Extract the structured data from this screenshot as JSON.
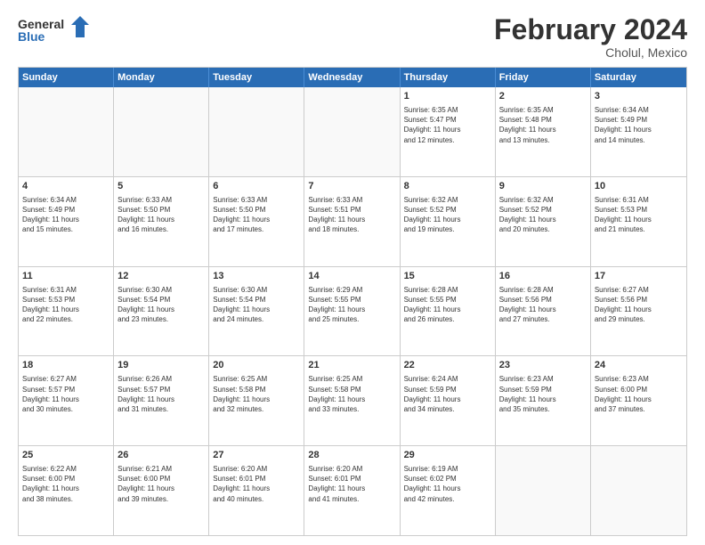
{
  "logo": {
    "line1": "General",
    "line2": "Blue"
  },
  "title": "February 2024",
  "subtitle": "Cholul, Mexico",
  "header_days": [
    "Sunday",
    "Monday",
    "Tuesday",
    "Wednesday",
    "Thursday",
    "Friday",
    "Saturday"
  ],
  "rows": [
    [
      {
        "day": "",
        "text": ""
      },
      {
        "day": "",
        "text": ""
      },
      {
        "day": "",
        "text": ""
      },
      {
        "day": "",
        "text": ""
      },
      {
        "day": "1",
        "text": "Sunrise: 6:35 AM\nSunset: 5:47 PM\nDaylight: 11 hours\nand 12 minutes."
      },
      {
        "day": "2",
        "text": "Sunrise: 6:35 AM\nSunset: 5:48 PM\nDaylight: 11 hours\nand 13 minutes."
      },
      {
        "day": "3",
        "text": "Sunrise: 6:34 AM\nSunset: 5:49 PM\nDaylight: 11 hours\nand 14 minutes."
      }
    ],
    [
      {
        "day": "4",
        "text": "Sunrise: 6:34 AM\nSunset: 5:49 PM\nDaylight: 11 hours\nand 15 minutes."
      },
      {
        "day": "5",
        "text": "Sunrise: 6:33 AM\nSunset: 5:50 PM\nDaylight: 11 hours\nand 16 minutes."
      },
      {
        "day": "6",
        "text": "Sunrise: 6:33 AM\nSunset: 5:50 PM\nDaylight: 11 hours\nand 17 minutes."
      },
      {
        "day": "7",
        "text": "Sunrise: 6:33 AM\nSunset: 5:51 PM\nDaylight: 11 hours\nand 18 minutes."
      },
      {
        "day": "8",
        "text": "Sunrise: 6:32 AM\nSunset: 5:52 PM\nDaylight: 11 hours\nand 19 minutes."
      },
      {
        "day": "9",
        "text": "Sunrise: 6:32 AM\nSunset: 5:52 PM\nDaylight: 11 hours\nand 20 minutes."
      },
      {
        "day": "10",
        "text": "Sunrise: 6:31 AM\nSunset: 5:53 PM\nDaylight: 11 hours\nand 21 minutes."
      }
    ],
    [
      {
        "day": "11",
        "text": "Sunrise: 6:31 AM\nSunset: 5:53 PM\nDaylight: 11 hours\nand 22 minutes."
      },
      {
        "day": "12",
        "text": "Sunrise: 6:30 AM\nSunset: 5:54 PM\nDaylight: 11 hours\nand 23 minutes."
      },
      {
        "day": "13",
        "text": "Sunrise: 6:30 AM\nSunset: 5:54 PM\nDaylight: 11 hours\nand 24 minutes."
      },
      {
        "day": "14",
        "text": "Sunrise: 6:29 AM\nSunset: 5:55 PM\nDaylight: 11 hours\nand 25 minutes."
      },
      {
        "day": "15",
        "text": "Sunrise: 6:28 AM\nSunset: 5:55 PM\nDaylight: 11 hours\nand 26 minutes."
      },
      {
        "day": "16",
        "text": "Sunrise: 6:28 AM\nSunset: 5:56 PM\nDaylight: 11 hours\nand 27 minutes."
      },
      {
        "day": "17",
        "text": "Sunrise: 6:27 AM\nSunset: 5:56 PM\nDaylight: 11 hours\nand 29 minutes."
      }
    ],
    [
      {
        "day": "18",
        "text": "Sunrise: 6:27 AM\nSunset: 5:57 PM\nDaylight: 11 hours\nand 30 minutes."
      },
      {
        "day": "19",
        "text": "Sunrise: 6:26 AM\nSunset: 5:57 PM\nDaylight: 11 hours\nand 31 minutes."
      },
      {
        "day": "20",
        "text": "Sunrise: 6:25 AM\nSunset: 5:58 PM\nDaylight: 11 hours\nand 32 minutes."
      },
      {
        "day": "21",
        "text": "Sunrise: 6:25 AM\nSunset: 5:58 PM\nDaylight: 11 hours\nand 33 minutes."
      },
      {
        "day": "22",
        "text": "Sunrise: 6:24 AM\nSunset: 5:59 PM\nDaylight: 11 hours\nand 34 minutes."
      },
      {
        "day": "23",
        "text": "Sunrise: 6:23 AM\nSunset: 5:59 PM\nDaylight: 11 hours\nand 35 minutes."
      },
      {
        "day": "24",
        "text": "Sunrise: 6:23 AM\nSunset: 6:00 PM\nDaylight: 11 hours\nand 37 minutes."
      }
    ],
    [
      {
        "day": "25",
        "text": "Sunrise: 6:22 AM\nSunset: 6:00 PM\nDaylight: 11 hours\nand 38 minutes."
      },
      {
        "day": "26",
        "text": "Sunrise: 6:21 AM\nSunset: 6:00 PM\nDaylight: 11 hours\nand 39 minutes."
      },
      {
        "day": "27",
        "text": "Sunrise: 6:20 AM\nSunset: 6:01 PM\nDaylight: 11 hours\nand 40 minutes."
      },
      {
        "day": "28",
        "text": "Sunrise: 6:20 AM\nSunset: 6:01 PM\nDaylight: 11 hours\nand 41 minutes."
      },
      {
        "day": "29",
        "text": "Sunrise: 6:19 AM\nSunset: 6:02 PM\nDaylight: 11 hours\nand 42 minutes."
      },
      {
        "day": "",
        "text": ""
      },
      {
        "day": "",
        "text": ""
      }
    ]
  ]
}
